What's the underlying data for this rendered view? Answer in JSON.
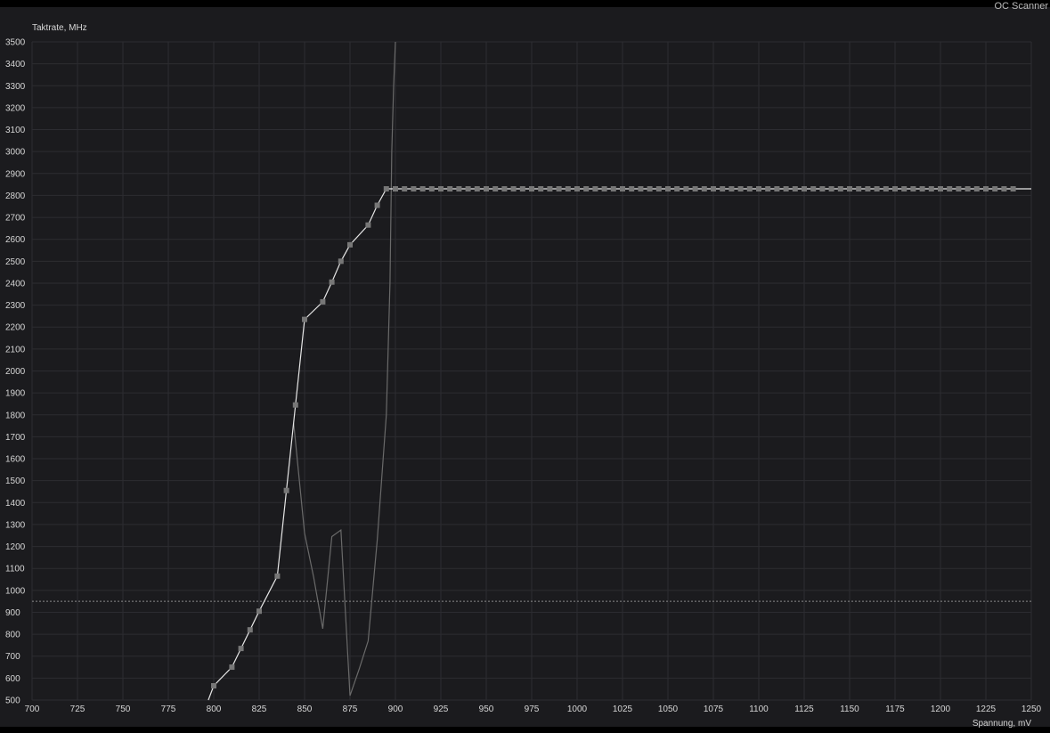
{
  "window": {
    "corner_label": "OC Scanner"
  },
  "chart_data": {
    "type": "line",
    "ylabel": "Taktrate, MHz",
    "xlabel": "Spannung, mV",
    "xlim": [
      700,
      1250
    ],
    "ylim": [
      500,
      3500
    ],
    "x_ticks": [
      700,
      725,
      750,
      775,
      800,
      825,
      850,
      875,
      900,
      925,
      950,
      975,
      1000,
      1025,
      1050,
      1075,
      1100,
      1125,
      1150,
      1175,
      1200,
      1225,
      1250
    ],
    "y_ticks": [
      500,
      600,
      700,
      800,
      900,
      1000,
      1100,
      1200,
      1300,
      1400,
      1500,
      1600,
      1700,
      1800,
      1900,
      2000,
      2100,
      2200,
      2300,
      2400,
      2500,
      2600,
      2700,
      2800,
      2900,
      3000,
      3100,
      3200,
      3300,
      3400,
      3500
    ],
    "reference_line_y": 950,
    "grid": true,
    "series": [
      {
        "color": "#e6e6e6",
        "markers": true,
        "points": [
          [
            797,
            500
          ],
          [
            800,
            565
          ],
          [
            810,
            650
          ],
          [
            815,
            735
          ],
          [
            820,
            820
          ],
          [
            825,
            905
          ],
          [
            835,
            1065
          ],
          [
            840,
            1455
          ],
          [
            845,
            1845
          ],
          [
            850,
            2235
          ],
          [
            860,
            2315
          ],
          [
            865,
            2405
          ],
          [
            870,
            2500
          ],
          [
            875,
            2575
          ],
          [
            885,
            2665
          ],
          [
            890,
            2755
          ],
          [
            895,
            2830
          ],
          [
            900,
            2830
          ],
          [
            905,
            2830
          ],
          [
            910,
            2830
          ],
          [
            915,
            2830
          ],
          [
            920,
            2830
          ],
          [
            925,
            2830
          ],
          [
            930,
            2830
          ],
          [
            935,
            2830
          ],
          [
            940,
            2830
          ],
          [
            945,
            2830
          ],
          [
            950,
            2830
          ],
          [
            955,
            2830
          ],
          [
            960,
            2830
          ],
          [
            965,
            2830
          ],
          [
            970,
            2830
          ],
          [
            975,
            2830
          ],
          [
            980,
            2830
          ],
          [
            985,
            2830
          ],
          [
            990,
            2830
          ],
          [
            995,
            2830
          ],
          [
            1000,
            2830
          ],
          [
            1005,
            2830
          ],
          [
            1010,
            2830
          ],
          [
            1015,
            2830
          ],
          [
            1020,
            2830
          ],
          [
            1025,
            2830
          ],
          [
            1030,
            2830
          ],
          [
            1035,
            2830
          ],
          [
            1040,
            2830
          ],
          [
            1045,
            2830
          ],
          [
            1050,
            2830
          ],
          [
            1055,
            2830
          ],
          [
            1060,
            2830
          ],
          [
            1065,
            2830
          ],
          [
            1070,
            2830
          ],
          [
            1075,
            2830
          ],
          [
            1080,
            2830
          ],
          [
            1085,
            2830
          ],
          [
            1090,
            2830
          ],
          [
            1095,
            2830
          ],
          [
            1100,
            2830
          ],
          [
            1105,
            2830
          ],
          [
            1110,
            2830
          ],
          [
            1115,
            2830
          ],
          [
            1120,
            2830
          ],
          [
            1125,
            2830
          ],
          [
            1130,
            2830
          ],
          [
            1135,
            2830
          ],
          [
            1140,
            2830
          ],
          [
            1145,
            2830
          ],
          [
            1150,
            2830
          ],
          [
            1155,
            2830
          ],
          [
            1160,
            2830
          ],
          [
            1165,
            2830
          ],
          [
            1170,
            2830
          ],
          [
            1175,
            2830
          ],
          [
            1180,
            2830
          ],
          [
            1185,
            2830
          ],
          [
            1190,
            2830
          ],
          [
            1195,
            2830
          ],
          [
            1200,
            2830
          ],
          [
            1205,
            2830
          ],
          [
            1210,
            2830
          ],
          [
            1215,
            2830
          ],
          [
            1220,
            2830
          ],
          [
            1225,
            2830
          ],
          [
            1230,
            2830
          ],
          [
            1235,
            2830
          ],
          [
            1240,
            2830
          ],
          [
            1250,
            2830
          ]
        ]
      },
      {
        "color": "#6a6a6a",
        "markers": false,
        "points": [
          [
            844,
            1760
          ],
          [
            850,
            1260
          ],
          [
            855,
            1060
          ],
          [
            860,
            825
          ],
          [
            865,
            1245
          ],
          [
            870,
            1275
          ],
          [
            875,
            520
          ],
          [
            880,
            640
          ],
          [
            885,
            770
          ],
          [
            890,
            1230
          ],
          [
            895,
            1800
          ],
          [
            897,
            2400
          ],
          [
            898,
            3000
          ],
          [
            899,
            3300
          ],
          [
            900,
            3500
          ]
        ]
      }
    ]
  }
}
